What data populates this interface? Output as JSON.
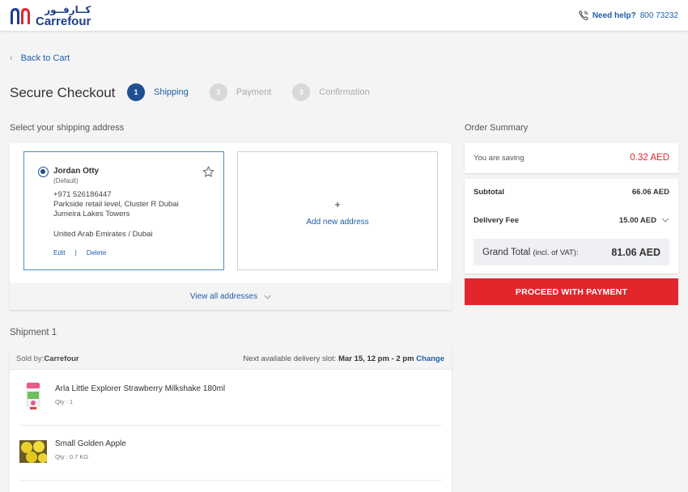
{
  "header": {
    "logo_arabic": "كــارفــور",
    "logo_english": "Carrefour",
    "help_label": "Need help?",
    "help_phone": "800 73232"
  },
  "nav": {
    "back_label": "Back to Cart"
  },
  "checkout": {
    "title": "Secure Checkout",
    "steps": [
      {
        "num": "1",
        "label": "Shipping",
        "state": "active"
      },
      {
        "num": "2",
        "label": "Payment",
        "state": "inactive"
      },
      {
        "num": "3",
        "label": "Confirmation",
        "state": "inactive"
      }
    ]
  },
  "shipping": {
    "section_label": "Select your shipping address",
    "address": {
      "name": "Jordan Otty",
      "tag": "(Default)",
      "phone": "+971 526186447",
      "line1": "Parkside retail level, Cluster R Dubai",
      "line2": "Jumeira Lakes Towers",
      "country_city": "United Arab Emirates / Dubai",
      "edit_label": "Edit",
      "separator": "|",
      "delete_label": "Delete"
    },
    "add_plus": "+",
    "add_label": "Add new address",
    "view_all_label": "View all addresses"
  },
  "summary": {
    "section_label": "Order Summary",
    "saving_label": "You are saving",
    "saving_value": "0.32 AED",
    "subtotal_label": "Subtotal",
    "subtotal_value": "66.06 AED",
    "delivery_label": "Delivery Fee",
    "delivery_value": "15.00 AED",
    "grand_label": "Grand Total",
    "grand_note": "(incl. of VAT):",
    "grand_value": "81.06 AED",
    "proceed_label": "PROCEED WITH PAYMENT"
  },
  "shipment": {
    "section_label": "Shipment 1",
    "sold_by_label": "Sold by:",
    "seller": "Carrefour",
    "slot_label": "Next available delivery slot:",
    "slot_value": "Mar 15, 12 pm - 2 pm",
    "change_label": "Change",
    "items": [
      {
        "name": "Arla Little Explorer Strawberry Milkshake 180ml",
        "qty": "Qty : 1"
      },
      {
        "name": "Small Golden Apple",
        "qty": "Qty : 0.7 KG"
      }
    ]
  },
  "colors": {
    "brand_blue": "#1f4f8f",
    "link_blue": "#1e5fa8",
    "brand_red": "#e3262c"
  }
}
